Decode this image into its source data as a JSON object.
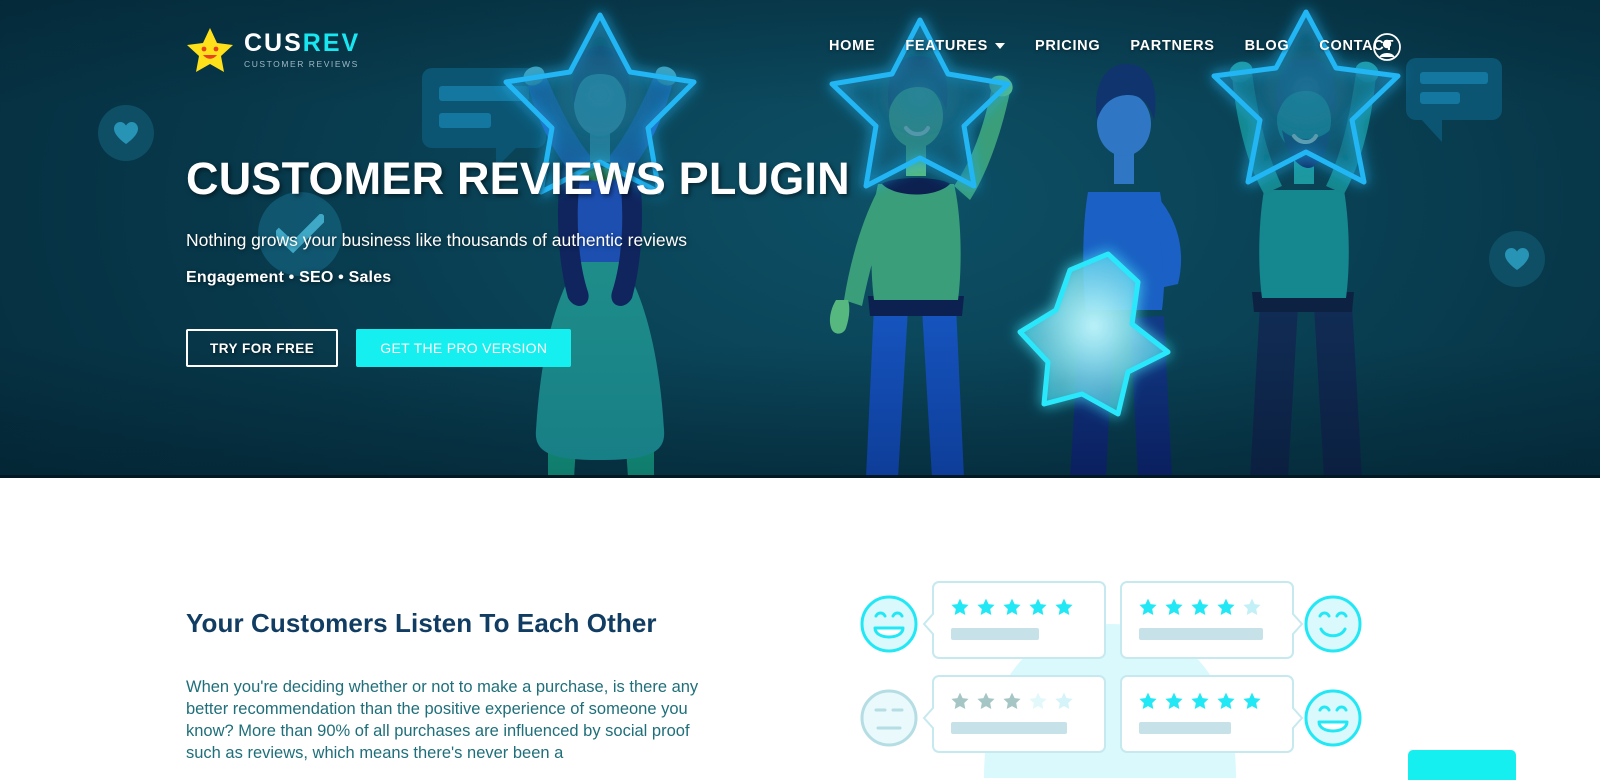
{
  "site": {
    "logo": {
      "text_primary": "CUS",
      "text_secondary": "REV",
      "tagline": "CUSTOMER REVIEWS",
      "star_color": "#ffe11b",
      "accent_color": "#18e7f2"
    },
    "nav": {
      "items": [
        {
          "label": "HOME",
          "has_dropdown": false
        },
        {
          "label": "FEATURES",
          "has_dropdown": true
        },
        {
          "label": "PRICING",
          "has_dropdown": false
        },
        {
          "label": "PARTNERS",
          "has_dropdown": false
        },
        {
          "label": "BLOG",
          "has_dropdown": false
        },
        {
          "label": "CONTACT",
          "has_dropdown": false
        }
      ],
      "account_icon": "user-account-icon"
    }
  },
  "hero": {
    "title": "CUSTOMER REVIEWS PLUGIN",
    "subtitle": "Nothing grows your business like thousands of authentic reviews",
    "tagline": "Engagement • SEO • Sales",
    "buttons": {
      "secondary_label": "TRY FOR FREE",
      "primary_label": "GET THE PRO VERSION",
      "primary_color": "#16efef"
    },
    "background_color": "#0a4256",
    "decorations": [
      {
        "name": "heart-circle-left",
        "icon": "heart-icon"
      },
      {
        "name": "check-circle",
        "icon": "check-icon"
      },
      {
        "name": "chat-bubble-left",
        "icon": "chat-bubble-icon"
      },
      {
        "name": "chat-bubble-right",
        "icon": "chat-bubble-icon"
      },
      {
        "name": "heart-circle-right",
        "icon": "heart-icon"
      }
    ]
  },
  "section": {
    "title": "Your Customers Listen To Each Other",
    "body": "When you're deciding whether or not to make a purchase, is there any better recommendation than the positive experience of someone you know? More than 90% of all purchases are influenced by social proof such as reviews, which means there's never been a",
    "text_color": "#1f6f7a",
    "title_color": "#123d63"
  },
  "reviews_art": {
    "cards": [
      {
        "position": "top-left",
        "stars_filled": 5,
        "stars_total": 5,
        "face": "grin-face",
        "face_tone": "bright"
      },
      {
        "position": "top-right",
        "stars_filled": 4,
        "stars_total": 5,
        "face": "smile-face",
        "face_tone": "bright"
      },
      {
        "position": "bottom-left",
        "stars_filled": 3,
        "stars_total": 5,
        "face": "neutral-face",
        "face_tone": "muted"
      },
      {
        "position": "bottom-right",
        "stars_filled": 5,
        "stars_total": 5,
        "face": "grin-face",
        "face_tone": "bright"
      }
    ],
    "star_active_color": "#22e8f5",
    "star_inactive_color": "#d8f7fb",
    "star_muted_color": "#9fc2c4"
  },
  "bottom_cta": {
    "name": "floating-cta-button",
    "color": "#16efef"
  }
}
